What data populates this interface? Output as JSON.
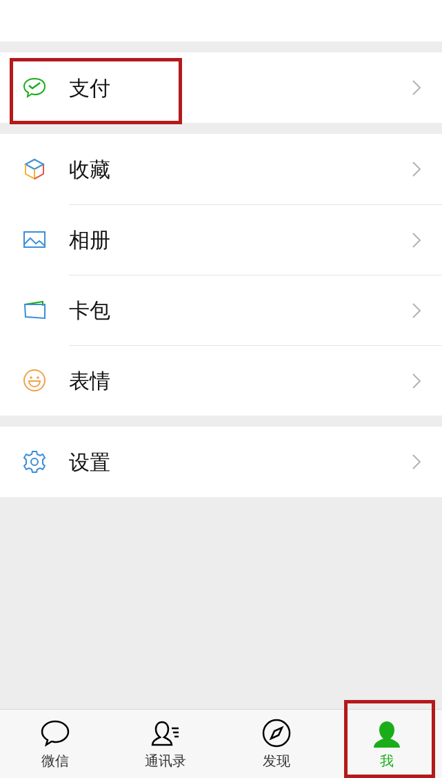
{
  "sections": [
    {
      "items": [
        {
          "label": "支付",
          "highlighted": true
        }
      ]
    },
    {
      "items": [
        {
          "label": "收藏",
          "highlighted": false
        },
        {
          "label": "相册",
          "highlighted": false
        },
        {
          "label": "卡包",
          "highlighted": false
        },
        {
          "label": "表情",
          "highlighted": false
        }
      ]
    },
    {
      "items": [
        {
          "label": "设置",
          "highlighted": false
        }
      ]
    }
  ],
  "tab_bar": {
    "tabs": [
      {
        "label": "微信",
        "selected": false,
        "highlighted": false
      },
      {
        "label": "通讯录",
        "selected": false,
        "highlighted": false
      },
      {
        "label": "发现",
        "selected": false,
        "highlighted": false
      },
      {
        "label": "我",
        "selected": true,
        "highlighted": true
      }
    ]
  }
}
